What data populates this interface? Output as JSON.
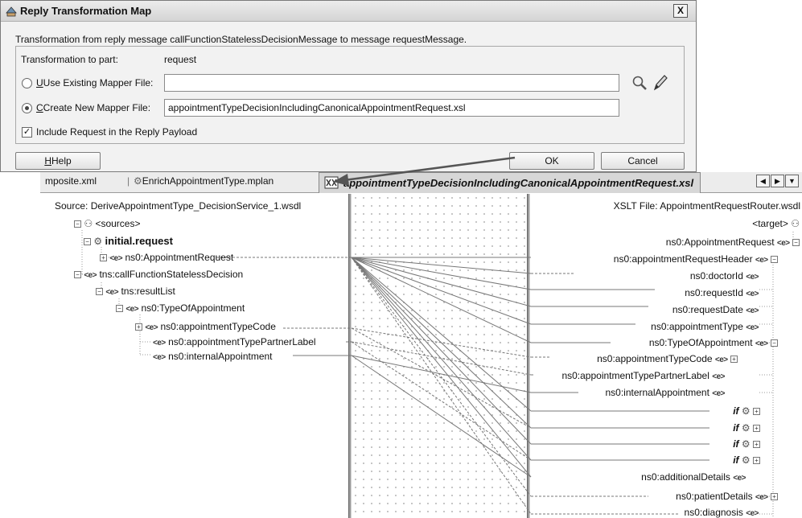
{
  "dialog": {
    "title": "Reply Transformation Map",
    "close": "X",
    "description": "Transformation from reply message callFunctionStatelessDecisionMessage to message requestMessage.",
    "part_label": "Transformation to part:",
    "part_value": "request",
    "use_existing_label": "Use Existing Mapper File:",
    "use_existing_value": "",
    "create_new_label": "Create New Mapper File:",
    "create_new_value": "appointmentTypeDecisionIncludingCanonicalAppointmentRequest.xsl",
    "include_request_label": "Include Request in the Reply Payload",
    "include_request_checked": true,
    "help": "Help",
    "ok": "OK",
    "cancel": "Cancel"
  },
  "tabs": {
    "tab1": "mposite.xml",
    "tab2": "EnrichAppointmentType.mplan",
    "tab3": "appointmentTypeDecisionIncludingCanonicalAppointmentRequest.xsl"
  },
  "source": {
    "header": "Source: DeriveAppointmentType_DecisionService_1.wsdl",
    "nodes": {
      "sources": "<sources>",
      "initial_request": "initial.request",
      "appointment_request": "ns0:AppointmentRequest",
      "call_function": "tns:callFunctionStatelessDecision",
      "result_list": "tns:resultList",
      "type_of_appointment": "ns0:TypeOfAppointment",
      "appointment_type_code": "ns0:appointmentTypeCode",
      "partner_label": "ns0:appointmentTypePartnerLabel",
      "internal_appointment": "ns0:internalAppointment"
    }
  },
  "target": {
    "header": "XSLT File: AppointmentRequestRouter.wsdl",
    "nodes": {
      "target": "<target>",
      "appointment_request": "ns0:AppointmentRequest",
      "request_header": "ns0:appointmentRequestHeader",
      "doctor_id": "ns0:doctorId",
      "request_id": "ns0:requestId",
      "request_date": "ns0:requestDate",
      "appointment_type": "ns0:appointmentType",
      "type_of_appointment": "ns0:TypeOfAppointment",
      "appointment_type_code": "ns0:appointmentTypeCode",
      "partner_label": "ns0:appointmentTypePartnerLabel",
      "internal_appointment": "ns0:internalAppointment",
      "if_label": "if",
      "additional_details": "ns0:additionalDetails",
      "patient_details": "ns0:patientDetails",
      "diagnosis": "ns0:diagnosis"
    }
  },
  "element_icon_text": "<e>",
  "icons": [
    "search-icon",
    "edit-pencil-icon",
    "xsl-file-icon",
    "schema-icon",
    "expand-icon",
    "collapse-icon"
  ]
}
